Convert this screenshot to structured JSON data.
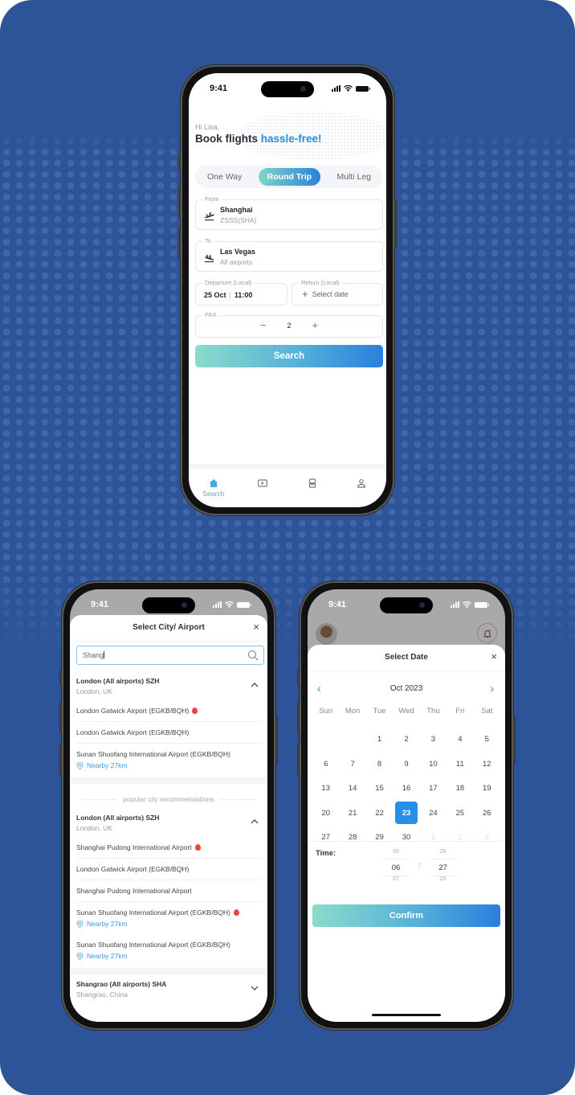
{
  "status_time": "9:41",
  "search_screen": {
    "greeting": "Hi Lisa,",
    "headline_prefix": "Book flights ",
    "headline_accent": "hassle-free!",
    "trip_tabs": [
      {
        "label": "One Way",
        "active": false
      },
      {
        "label": "Round Trip",
        "active": true
      },
      {
        "label": "Multi Leg",
        "active": false
      }
    ],
    "from": {
      "label": "From",
      "city": "Shanghai",
      "code": "ZSSS(SHA)"
    },
    "to": {
      "label": "To",
      "city": "Las Vegas",
      "code": "All airports"
    },
    "departure": {
      "label": "Departure (Local)",
      "date": "25 Oct",
      "time": "11:00"
    },
    "return": {
      "label": "Return (Local)",
      "placeholder": "Select date"
    },
    "pax": {
      "label": "PAX",
      "value": "2",
      "minus": "−",
      "plus": "+"
    },
    "search_button": "Search",
    "tabbar": [
      {
        "label": "Search",
        "icon": "home-icon",
        "active": true
      },
      {
        "label": "",
        "icon": "ticket-icon",
        "active": false
      },
      {
        "label": "",
        "icon": "luggage-icon",
        "active": false
      },
      {
        "label": "",
        "icon": "profile-icon",
        "active": false
      }
    ]
  },
  "city_screen": {
    "title": "Select City/ Airport",
    "close": "×",
    "search_value": "Shang",
    "groups": [
      {
        "name": "London (All airports) SZH",
        "location": "London, UK",
        "expanded": true,
        "airports": [
          {
            "name": "London Gatwick Airport (EGKB/BQH)",
            "hot": true,
            "nearby": ""
          },
          {
            "name": "London Gatwick Airport (EGKB/BQH)",
            "hot": false,
            "nearby": ""
          },
          {
            "name": "Sunan Shuofang International Airport (EGKB/BQH)",
            "hot": false,
            "nearby": "Nearby 27km"
          }
        ]
      }
    ],
    "popular_label": "popular city recommendations",
    "popular_groups": [
      {
        "name": "London (All airports) SZH",
        "location": "London, UK",
        "expanded": true,
        "airports": [
          {
            "name": "Shanghai Pudong International Airport",
            "hot": true,
            "nearby": ""
          },
          {
            "name": "London Gatwick Airport (EGKB/BQH)",
            "hot": false,
            "nearby": ""
          },
          {
            "name": "Shanghai Pudong International Airport",
            "hot": false,
            "nearby": ""
          },
          {
            "name": "Sunan Shuofang International Airport (EGKB/BQH)",
            "hot": true,
            "nearby": "Nearby 27km"
          },
          {
            "name": "Sunan Shuofang International Airport (EGKB/BQH)",
            "hot": false,
            "nearby": "Nearby 27km"
          }
        ]
      },
      {
        "name": "Shangrao (All airports) SHA",
        "location": "Shangrao, China",
        "expanded": false,
        "airports": []
      }
    ]
  },
  "date_screen": {
    "title": "Select Date",
    "close": "×",
    "month": "Oct 2023",
    "prev": "‹",
    "next": "›",
    "weekdays": [
      "Sun",
      "Mon",
      "Tue",
      "Wed",
      "Thu",
      "Fri",
      "Sat"
    ],
    "days": [
      {
        "d": "",
        "m": false
      },
      {
        "d": "",
        "m": false
      },
      {
        "d": "1"
      },
      {
        "d": "2"
      },
      {
        "d": "3"
      },
      {
        "d": "4"
      },
      {
        "d": "5"
      },
      {
        "d": "6"
      },
      {
        "d": "7"
      },
      {
        "d": "8"
      },
      {
        "d": "9"
      },
      {
        "d": "10"
      },
      {
        "d": "11"
      },
      {
        "d": "12"
      },
      {
        "d": "13"
      },
      {
        "d": "14"
      },
      {
        "d": "15"
      },
      {
        "d": "16"
      },
      {
        "d": "17"
      },
      {
        "d": "18"
      },
      {
        "d": "19"
      },
      {
        "d": "20"
      },
      {
        "d": "21"
      },
      {
        "d": "22"
      },
      {
        "d": "23",
        "selected": true
      },
      {
        "d": "24"
      },
      {
        "d": "25"
      },
      {
        "d": "26"
      },
      {
        "d": "27"
      },
      {
        "d": "28"
      },
      {
        "d": "29"
      },
      {
        "d": "30"
      },
      {
        "d": "1",
        "muted": true
      },
      {
        "d": "2",
        "muted": true
      },
      {
        "d": "3",
        "muted": true
      }
    ],
    "time_label": "Time:",
    "hours": {
      "prev": "05",
      "current": "06",
      "next": "07"
    },
    "minutes": {
      "prev": "26",
      "current": "27",
      "next": "29"
    },
    "separator": ":",
    "confirm_button": "Confirm"
  },
  "colors": {
    "background": "#2d5398",
    "accent": "#2b8bd8",
    "selected_day": "#2590e8",
    "hot": "#e8453c",
    "gradient_start": "#8bdccb",
    "gradient_end": "#2a7fdc"
  }
}
